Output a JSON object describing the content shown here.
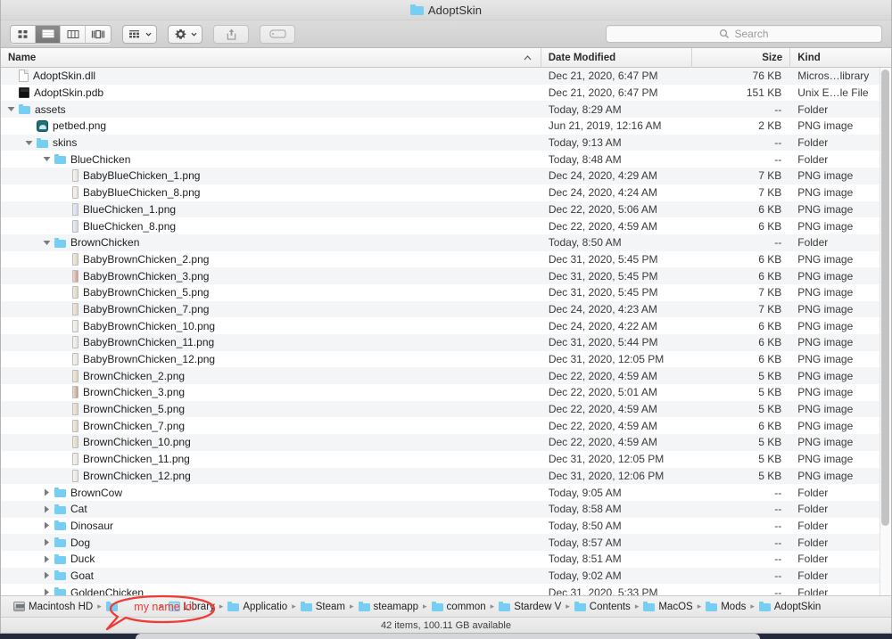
{
  "window": {
    "title": "AdoptSkin",
    "title_icon": "folder-icon"
  },
  "toolbar": {
    "view_modes": [
      {
        "name": "icon-view",
        "icon": "grid-icon",
        "active": false
      },
      {
        "name": "list-view",
        "icon": "list-icon",
        "active": true
      },
      {
        "name": "column-view",
        "icon": "columns-icon",
        "active": false
      },
      {
        "name": "gallery-view",
        "icon": "gallery-icon",
        "active": false
      }
    ],
    "group_by": {
      "icon": "group-icon",
      "chevron": "chevron-down-icon"
    },
    "action": {
      "icon": "gear-icon",
      "chevron": "chevron-down-icon"
    },
    "share": {
      "icon": "share-icon"
    },
    "tags": {
      "icon": "tag-icon"
    }
  },
  "search": {
    "icon": "search-icon",
    "placeholder": "Search",
    "value": ""
  },
  "columns": {
    "name": "Name",
    "date_modified": "Date Modified",
    "size": "Size",
    "kind": "Kind",
    "sort_indicator": "^"
  },
  "files": [
    {
      "name": "AdoptSkin.dll",
      "depth": 0,
      "icon": "document-icon",
      "twisty": "",
      "date": "Dec 21, 2020, 6:47 PM",
      "size": "76 KB",
      "kind": "Micros…library"
    },
    {
      "name": "AdoptSkin.pdb",
      "depth": 0,
      "icon": "binary-icon",
      "twisty": "",
      "date": "Dec 21, 2020, 6:47 PM",
      "size": "151 KB",
      "kind": "Unix E…le File"
    },
    {
      "name": "assets",
      "depth": 0,
      "icon": "folder-icon",
      "twisty": "expanded",
      "date": "Today, 8:29 AM",
      "size": "--",
      "kind": "Folder"
    },
    {
      "name": "petbed.png",
      "depth": 1,
      "icon": "petbed-icon",
      "twisty": "",
      "date": "Jun 21, 2019, 12:16 AM",
      "size": "2 KB",
      "kind": "PNG image"
    },
    {
      "name": "skins",
      "depth": 1,
      "icon": "folder-icon",
      "twisty": "expanded",
      "date": "Today, 9:13 AM",
      "size": "--",
      "kind": "Folder"
    },
    {
      "name": "BlueChicken",
      "depth": 2,
      "icon": "folder-icon",
      "twisty": "expanded",
      "date": "Today, 8:48 AM",
      "size": "--",
      "kind": "Folder"
    },
    {
      "name": "BabyBlueChicken_1.png",
      "depth": 3,
      "icon": "png-pale-icon",
      "twisty": "",
      "date": "Dec 24, 2020, 4:29 AM",
      "size": "7 KB",
      "kind": "PNG image"
    },
    {
      "name": "BabyBlueChicken_8.png",
      "depth": 3,
      "icon": "png-pale-icon",
      "twisty": "",
      "date": "Dec 24, 2020, 4:24 AM",
      "size": "7 KB",
      "kind": "PNG image"
    },
    {
      "name": "BlueChicken_1.png",
      "depth": 3,
      "icon": "png-blue-icon",
      "twisty": "",
      "date": "Dec 22, 2020, 5:06 AM",
      "size": "6 KB",
      "kind": "PNG image"
    },
    {
      "name": "BlueChicken_8.png",
      "depth": 3,
      "icon": "png-blue-icon",
      "twisty": "",
      "date": "Dec 22, 2020, 4:59 AM",
      "size": "6 KB",
      "kind": "PNG image"
    },
    {
      "name": "BrownChicken",
      "depth": 2,
      "icon": "folder-icon",
      "twisty": "expanded",
      "date": "Today, 8:50 AM",
      "size": "--",
      "kind": "Folder"
    },
    {
      "name": "BabyBrownChicken_2.png",
      "depth": 3,
      "icon": "png-tan-icon",
      "twisty": "",
      "date": "Dec 31, 2020, 5:45 PM",
      "size": "6 KB",
      "kind": "PNG image"
    },
    {
      "name": "BabyBrownChicken_3.png",
      "depth": 3,
      "icon": "png-red-icon",
      "twisty": "",
      "date": "Dec 31, 2020, 5:45 PM",
      "size": "6 KB",
      "kind": "PNG image"
    },
    {
      "name": "BabyBrownChicken_5.png",
      "depth": 3,
      "icon": "png-tan-icon",
      "twisty": "",
      "date": "Dec 31, 2020, 5:45 PM",
      "size": "7 KB",
      "kind": "PNG image"
    },
    {
      "name": "BabyBrownChicken_7.png",
      "depth": 3,
      "icon": "png-tan-icon",
      "twisty": "",
      "date": "Dec 24, 2020, 4:23 AM",
      "size": "7 KB",
      "kind": "PNG image"
    },
    {
      "name": "BabyBrownChicken_10.png",
      "depth": 3,
      "icon": "png-pale-icon",
      "twisty": "",
      "date": "Dec 24, 2020, 4:22 AM",
      "size": "6 KB",
      "kind": "PNG image"
    },
    {
      "name": "BabyBrownChicken_11.png",
      "depth": 3,
      "icon": "png-pale-icon",
      "twisty": "",
      "date": "Dec 31, 2020, 5:44 PM",
      "size": "6 KB",
      "kind": "PNG image"
    },
    {
      "name": "BabyBrownChicken_12.png",
      "depth": 3,
      "icon": "png-pale-icon",
      "twisty": "",
      "date": "Dec 31, 2020, 12:05 PM",
      "size": "6 KB",
      "kind": "PNG image"
    },
    {
      "name": "BrownChicken_2.png",
      "depth": 3,
      "icon": "png-tan-icon",
      "twisty": "",
      "date": "Dec 22, 2020, 4:59 AM",
      "size": "5 KB",
      "kind": "PNG image"
    },
    {
      "name": "BrownChicken_3.png",
      "depth": 3,
      "icon": "png-red-icon",
      "twisty": "",
      "date": "Dec 22, 2020, 5:01 AM",
      "size": "5 KB",
      "kind": "PNG image"
    },
    {
      "name": "BrownChicken_5.png",
      "depth": 3,
      "icon": "png-tan-icon",
      "twisty": "",
      "date": "Dec 22, 2020, 4:59 AM",
      "size": "5 KB",
      "kind": "PNG image"
    },
    {
      "name": "BrownChicken_7.png",
      "depth": 3,
      "icon": "png-tan-icon",
      "twisty": "",
      "date": "Dec 22, 2020, 4:59 AM",
      "size": "6 KB",
      "kind": "PNG image"
    },
    {
      "name": "BrownChicken_10.png",
      "depth": 3,
      "icon": "png-tan-icon",
      "twisty": "",
      "date": "Dec 22, 2020, 4:59 AM",
      "size": "5 KB",
      "kind": "PNG image"
    },
    {
      "name": "BrownChicken_11.png",
      "depth": 3,
      "icon": "png-pale-icon",
      "twisty": "",
      "date": "Dec 31, 2020, 12:05 PM",
      "size": "5 KB",
      "kind": "PNG image"
    },
    {
      "name": "BrownChicken_12.png",
      "depth": 3,
      "icon": "png-pale-icon",
      "twisty": "",
      "date": "Dec 31, 2020, 12:06 PM",
      "size": "5 KB",
      "kind": "PNG image"
    },
    {
      "name": "BrownCow",
      "depth": 2,
      "icon": "folder-icon",
      "twisty": "collapsed",
      "date": "Today, 9:05 AM",
      "size": "--",
      "kind": "Folder"
    },
    {
      "name": "Cat",
      "depth": 2,
      "icon": "folder-icon",
      "twisty": "collapsed",
      "date": "Today, 8:58 AM",
      "size": "--",
      "kind": "Folder"
    },
    {
      "name": "Dinosaur",
      "depth": 2,
      "icon": "folder-icon",
      "twisty": "collapsed",
      "date": "Today, 8:50 AM",
      "size": "--",
      "kind": "Folder"
    },
    {
      "name": "Dog",
      "depth": 2,
      "icon": "folder-icon",
      "twisty": "collapsed",
      "date": "Today, 8:57 AM",
      "size": "--",
      "kind": "Folder"
    },
    {
      "name": "Duck",
      "depth": 2,
      "icon": "folder-icon",
      "twisty": "collapsed",
      "date": "Today, 8:51 AM",
      "size": "--",
      "kind": "Folder"
    },
    {
      "name": "Goat",
      "depth": 2,
      "icon": "folder-icon",
      "twisty": "collapsed",
      "date": "Today, 9:02 AM",
      "size": "--",
      "kind": "Folder"
    },
    {
      "name": "GoldenChicken",
      "depth": 2,
      "icon": "folder-icon",
      "twisty": "collapsed",
      "date": "Dec 31, 2020, 5:33 PM",
      "size": "--",
      "kind": "Folder"
    }
  ],
  "path_bar": [
    {
      "label": "Macintosh HD",
      "icon": "harddisk-icon"
    },
    {
      "label": "",
      "icon": "folder-icon",
      "obscured": true
    },
    {
      "label": "Library",
      "icon": "library-folder-icon"
    },
    {
      "label": "Applicatio",
      "icon": "folder-icon"
    },
    {
      "label": "Steam",
      "icon": "folder-icon"
    },
    {
      "label": "steamapp",
      "icon": "folder-icon"
    },
    {
      "label": "common",
      "icon": "folder-icon"
    },
    {
      "label": "Stardew V",
      "icon": "folder-icon"
    },
    {
      "label": "Contents",
      "icon": "folder-icon"
    },
    {
      "label": "MacOS",
      "icon": "folder-icon"
    },
    {
      "label": "Mods",
      "icon": "folder-icon"
    },
    {
      "label": "AdoptSkin",
      "icon": "folder-icon"
    }
  ],
  "status_bar": {
    "text": "42 items, 100.11 GB available"
  },
  "annotation": {
    "text": "my name lol",
    "color": "#ef3b35",
    "shape": "speech-bubble"
  },
  "colors": {
    "folder_blue": "#76cff2",
    "annotation_red": "#ef3b35",
    "desktop": "#232a3d",
    "row_alt": "#f4f5f7"
  }
}
